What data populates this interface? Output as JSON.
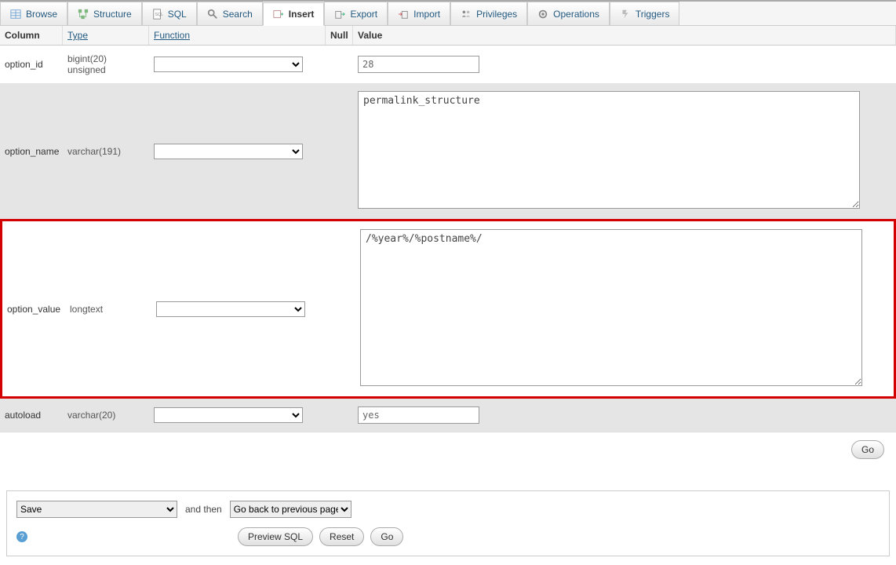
{
  "tabs": {
    "browse": "Browse",
    "structure": "Structure",
    "sql": "SQL",
    "search": "Search",
    "insert": "Insert",
    "export": "Export",
    "import": "Import",
    "privileges": "Privileges",
    "operations": "Operations",
    "triggers": "Triggers"
  },
  "headers": {
    "column": "Column",
    "type": "Type",
    "function": "Function",
    "null": "Null",
    "value": "Value"
  },
  "rows": {
    "r0": {
      "col": "option_id",
      "type": "bigint(20) unsigned",
      "value": "28"
    },
    "r1": {
      "col": "option_name",
      "type": "varchar(191)",
      "value": "permalink_structure"
    },
    "r2": {
      "col": "option_value",
      "type": "longtext",
      "value": "/%year%/%postname%/"
    },
    "r3": {
      "col": "autoload",
      "type": "varchar(20)",
      "value": "yes"
    }
  },
  "go": "Go",
  "footer": {
    "save": "Save",
    "and_then": "and then",
    "goback": "Go back to previous page",
    "preview": "Preview SQL",
    "reset": "Reset",
    "go": "Go"
  }
}
